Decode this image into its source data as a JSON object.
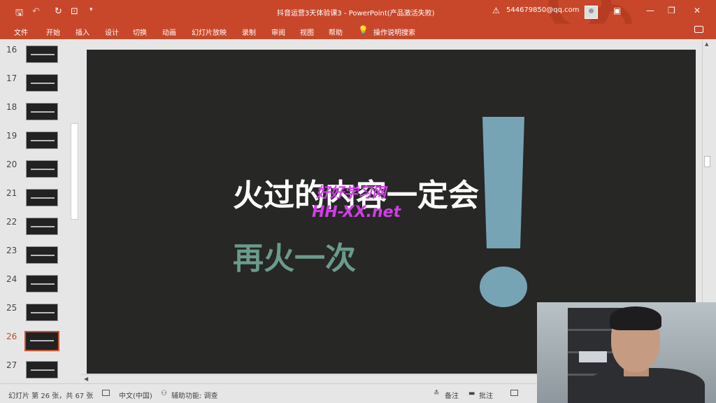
{
  "window": {
    "title": "抖音运营3天体验课3 - PowerPoint(产品激活失败)",
    "account": "544679850@qq.com"
  },
  "ribbon": {
    "tabs": [
      "文件",
      "开始",
      "插入",
      "设计",
      "切换",
      "动画",
      "幻灯片放映",
      "录制",
      "审阅",
      "视图",
      "帮助"
    ],
    "tell_me": "操作说明搜索"
  },
  "thumbnails": {
    "numbers": [
      "16",
      "17",
      "18",
      "19",
      "20",
      "21",
      "22",
      "23",
      "24",
      "25",
      "26",
      "27"
    ],
    "selected": "26"
  },
  "slide": {
    "headline": "火过的内容一定会",
    "subline": "再火一次",
    "accent_colors": {
      "headline": "#ffffff",
      "subline": "#6a9b8c",
      "exclamation": "#77a4b4",
      "background": "#272725"
    }
  },
  "watermark": {
    "line1": "好好学习网",
    "line2": "HH-XX.net"
  },
  "status": {
    "slide_info": "幻灯片 第 26 张，共 67 张",
    "language": "中文(中国)",
    "accessibility": "辅助功能: 调查",
    "notes": "备注",
    "comments": "批注"
  },
  "theme": {
    "ribbon_color": "#c8472a"
  }
}
